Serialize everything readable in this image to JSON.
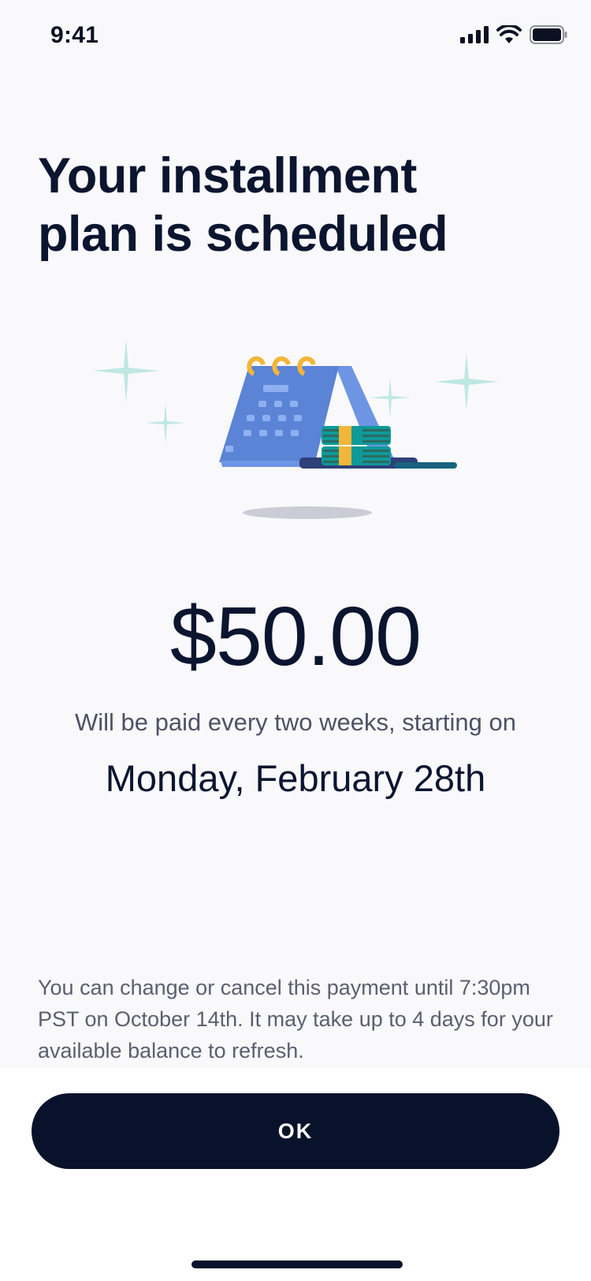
{
  "status_bar": {
    "time": "9:41",
    "icons": [
      "cellular-signal-icon",
      "wifi-icon",
      "battery-icon"
    ]
  },
  "header": {
    "title_line1": "Your installment",
    "title_line2": "plan is scheduled"
  },
  "illustration": {
    "name": "calendar-with-money-illustration",
    "colors": {
      "calendar": "#5b83d6",
      "rings": "#f2b63a",
      "money": "#0f9a9a",
      "sparkle": "#bfe7e4"
    }
  },
  "payment": {
    "amount": "$50.00",
    "frequency_text": "Will be paid every two weeks, starting on",
    "start_date": "Monday, February 28th"
  },
  "disclaimer": {
    "text": "You can change or cancel this payment until 7:30pm PST on October 14th. It may take up to 4 days for your available balance to refresh."
  },
  "actions": {
    "ok_label": "OK"
  },
  "colors": {
    "primary_dark": "#09122b",
    "background": "#f9f9fb",
    "muted_text": "#4e5266"
  }
}
